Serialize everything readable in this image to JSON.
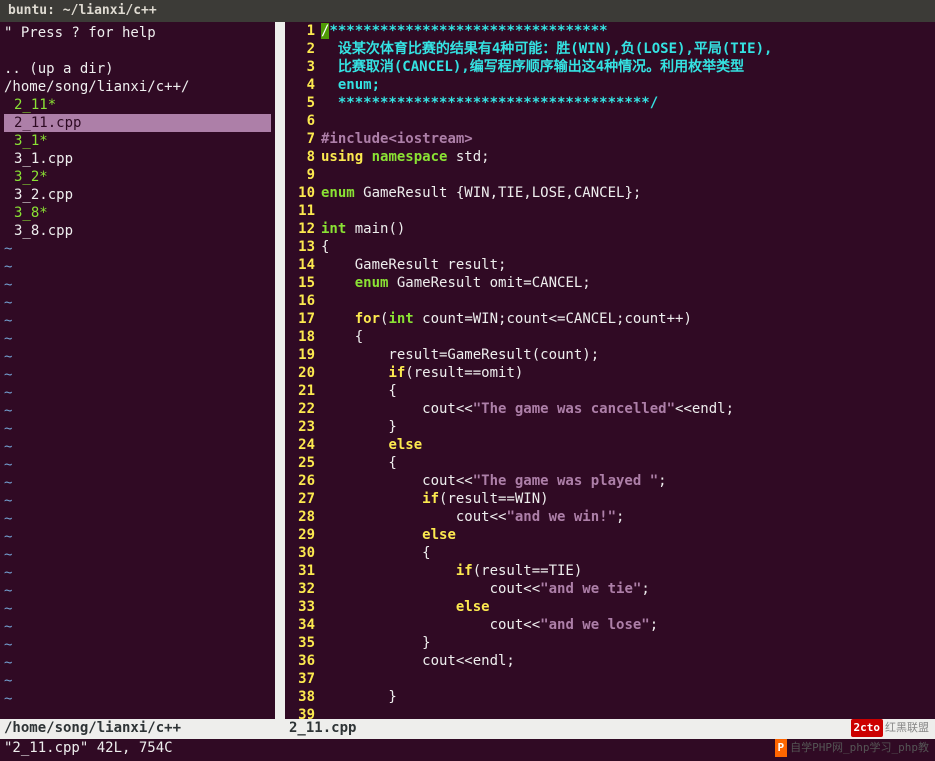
{
  "titlebar": "buntu: ~/lianxi/c++",
  "sidebar": {
    "help": "\" Press ? for help",
    "updir": ".. (up a dir)",
    "path": "/home/song/lianxi/c++/",
    "files": [
      {
        "name": "2_11*",
        "exec": true
      },
      {
        "name": "2_11.cpp",
        "sel": true
      },
      {
        "name": "3_1*",
        "exec": true
      },
      {
        "name": "3_1.cpp"
      },
      {
        "name": "3_2*",
        "exec": true
      },
      {
        "name": "3_2.cpp"
      },
      {
        "name": "3_8*",
        "exec": true
      },
      {
        "name": "3_8.cpp"
      }
    ]
  },
  "code": {
    "lines": [
      {
        "n": 1,
        "seg": [
          [
            "cursor",
            "/"
          ],
          [
            "comment",
            "*********************************"
          ]
        ]
      },
      {
        "n": 2,
        "seg": [
          [
            "comment",
            "  设某次体育比赛的结果有4种可能：胜(WIN),负(LOSE),平局(TIE),"
          ]
        ]
      },
      {
        "n": 3,
        "seg": [
          [
            "comment",
            "  比赛取消(CANCEL),编写程序顺序输出这4种情况。利用枚举类型"
          ]
        ]
      },
      {
        "n": 4,
        "seg": [
          [
            "comment",
            "  enum;"
          ]
        ]
      },
      {
        "n": 5,
        "seg": [
          [
            "comment",
            "  *************************************/"
          ]
        ]
      },
      {
        "n": 6,
        "seg": []
      },
      {
        "n": 7,
        "seg": [
          [
            "pre",
            "#include"
          ],
          [
            "str",
            "<iostream>"
          ]
        ]
      },
      {
        "n": 8,
        "seg": [
          [
            "kw",
            "using"
          ],
          [
            "id",
            " "
          ],
          [
            "type",
            "namespace"
          ],
          [
            "id",
            " std;"
          ]
        ]
      },
      {
        "n": 9,
        "seg": []
      },
      {
        "n": 10,
        "seg": [
          [
            "type",
            "enum"
          ],
          [
            "id",
            " GameResult {WIN,TIE,LOSE,CANCEL};"
          ]
        ]
      },
      {
        "n": 11,
        "seg": []
      },
      {
        "n": 12,
        "seg": [
          [
            "type",
            "int"
          ],
          [
            "id",
            " main()"
          ]
        ]
      },
      {
        "n": 13,
        "seg": [
          [
            "id",
            "{"
          ]
        ]
      },
      {
        "n": 14,
        "seg": [
          [
            "id",
            "    GameResult result;"
          ]
        ]
      },
      {
        "n": 15,
        "seg": [
          [
            "id",
            "    "
          ],
          [
            "type",
            "enum"
          ],
          [
            "id",
            " GameResult omit=CANCEL;"
          ]
        ]
      },
      {
        "n": 16,
        "seg": []
      },
      {
        "n": 17,
        "seg": [
          [
            "id",
            "    "
          ],
          [
            "kw",
            "for"
          ],
          [
            "id",
            "("
          ],
          [
            "type",
            "int"
          ],
          [
            "id",
            " count=WIN;count<=CANCEL;count++)"
          ]
        ]
      },
      {
        "n": 18,
        "seg": [
          [
            "id",
            "    {"
          ]
        ]
      },
      {
        "n": 19,
        "seg": [
          [
            "id",
            "        result=GameResult(count);"
          ]
        ]
      },
      {
        "n": 20,
        "seg": [
          [
            "id",
            "        "
          ],
          [
            "kw",
            "if"
          ],
          [
            "id",
            "(result==omit)"
          ]
        ]
      },
      {
        "n": 21,
        "seg": [
          [
            "id",
            "        {"
          ]
        ]
      },
      {
        "n": 22,
        "seg": [
          [
            "id",
            "            cout<<"
          ],
          [
            "str",
            "\"The game was cancelled\""
          ],
          [
            "id",
            "<<endl;"
          ]
        ]
      },
      {
        "n": 23,
        "seg": [
          [
            "id",
            "        }"
          ]
        ]
      },
      {
        "n": 24,
        "seg": [
          [
            "id",
            "        "
          ],
          [
            "kw",
            "else"
          ]
        ]
      },
      {
        "n": 25,
        "seg": [
          [
            "id",
            "        {"
          ]
        ]
      },
      {
        "n": 26,
        "seg": [
          [
            "id",
            "            cout<<"
          ],
          [
            "str",
            "\"The game was played \""
          ],
          [
            "id",
            ";"
          ]
        ]
      },
      {
        "n": 27,
        "seg": [
          [
            "id",
            "            "
          ],
          [
            "kw",
            "if"
          ],
          [
            "id",
            "(result==WIN)"
          ]
        ]
      },
      {
        "n": 28,
        "seg": [
          [
            "id",
            "                cout<<"
          ],
          [
            "str",
            "\"and we win!\""
          ],
          [
            "id",
            ";"
          ]
        ]
      },
      {
        "n": 29,
        "seg": [
          [
            "id",
            "            "
          ],
          [
            "kw",
            "else"
          ]
        ]
      },
      {
        "n": 30,
        "seg": [
          [
            "id",
            "            {"
          ]
        ]
      },
      {
        "n": 31,
        "seg": [
          [
            "id",
            "                "
          ],
          [
            "kw",
            "if"
          ],
          [
            "id",
            "(result==TIE)"
          ]
        ]
      },
      {
        "n": 32,
        "seg": [
          [
            "id",
            "                    cout<<"
          ],
          [
            "str",
            "\"and we tie\""
          ],
          [
            "id",
            ";"
          ]
        ]
      },
      {
        "n": 33,
        "seg": [
          [
            "id",
            "                "
          ],
          [
            "kw",
            "else"
          ]
        ]
      },
      {
        "n": 34,
        "seg": [
          [
            "id",
            "                    cout<<"
          ],
          [
            "str",
            "\"and we lose\""
          ],
          [
            "id",
            ";"
          ]
        ]
      },
      {
        "n": 35,
        "seg": [
          [
            "id",
            "            }"
          ]
        ]
      },
      {
        "n": 36,
        "seg": [
          [
            "id",
            "            cout<<endl;"
          ]
        ]
      },
      {
        "n": 37,
        "seg": []
      },
      {
        "n": 38,
        "seg": [
          [
            "id",
            "        }"
          ]
        ]
      },
      {
        "n": 39,
        "seg": []
      }
    ]
  },
  "status": {
    "left": "/home/song/lianxi/c++",
    "right": "2_11.cpp"
  },
  "cmdline": "\"2_11.cpp\" 42L, 754C",
  "watermark1_logo": "2cto",
  "watermark1_text": "红黑联盟",
  "watermark2_p": "P",
  "watermark2_text": "自学PHP网_php学习_php教"
}
